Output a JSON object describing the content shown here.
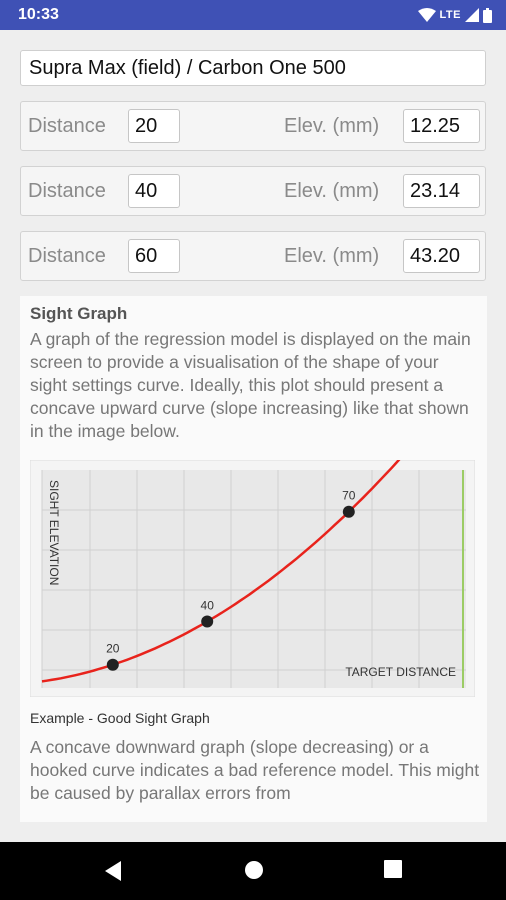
{
  "status_bar": {
    "time": "10:33",
    "network": "LTE",
    "icons": [
      "wifi-icon",
      "signal-icon",
      "battery-icon"
    ]
  },
  "title_field": {
    "value": "Supra Max (field) / Carbon One 500"
  },
  "rows": [
    {
      "distance_label": "Distance",
      "distance": "20",
      "elevation_label": "Elev. (mm)",
      "elevation": "12.25"
    },
    {
      "distance_label": "Distance",
      "distance": "40",
      "elevation_label": "Elev. (mm)",
      "elevation": "23.14"
    },
    {
      "distance_label": "Distance",
      "distance": "60",
      "elevation_label": "Elev. (mm)",
      "elevation": "43.20"
    }
  ],
  "help": {
    "heading": "Sight Graph",
    "paragraph1": "A graph of the regression model is displayed on the main screen to provide a visualisation of the shape of your sight settings curve. Ideally, this plot should present a concave upward curve (slope increasing) like that shown in the image below.",
    "caption": "Example - Good Sight Graph",
    "paragraph2": "A concave downward graph (slope decreasing) or a hooked curve indicates a bad reference model. This might be caused by parallax errors from"
  },
  "chart_data": {
    "type": "line",
    "xlabel": "TARGET DISTANCE",
    "ylabel": "SIGHT ELEVATION",
    "points": [
      {
        "x": 20,
        "label": "20"
      },
      {
        "x": 40,
        "label": "40"
      },
      {
        "x": 70,
        "label": "70"
      }
    ],
    "curve": "concave upward",
    "grid": true,
    "colors": {
      "curve": "#e8231c",
      "points": "#222222",
      "plot_bg": "#e8e8e8",
      "grid": "#d0d0d0",
      "right_edge": "#9ccc65"
    }
  },
  "nav": {
    "buttons": [
      "back-icon",
      "home-icon",
      "recents-icon"
    ]
  }
}
